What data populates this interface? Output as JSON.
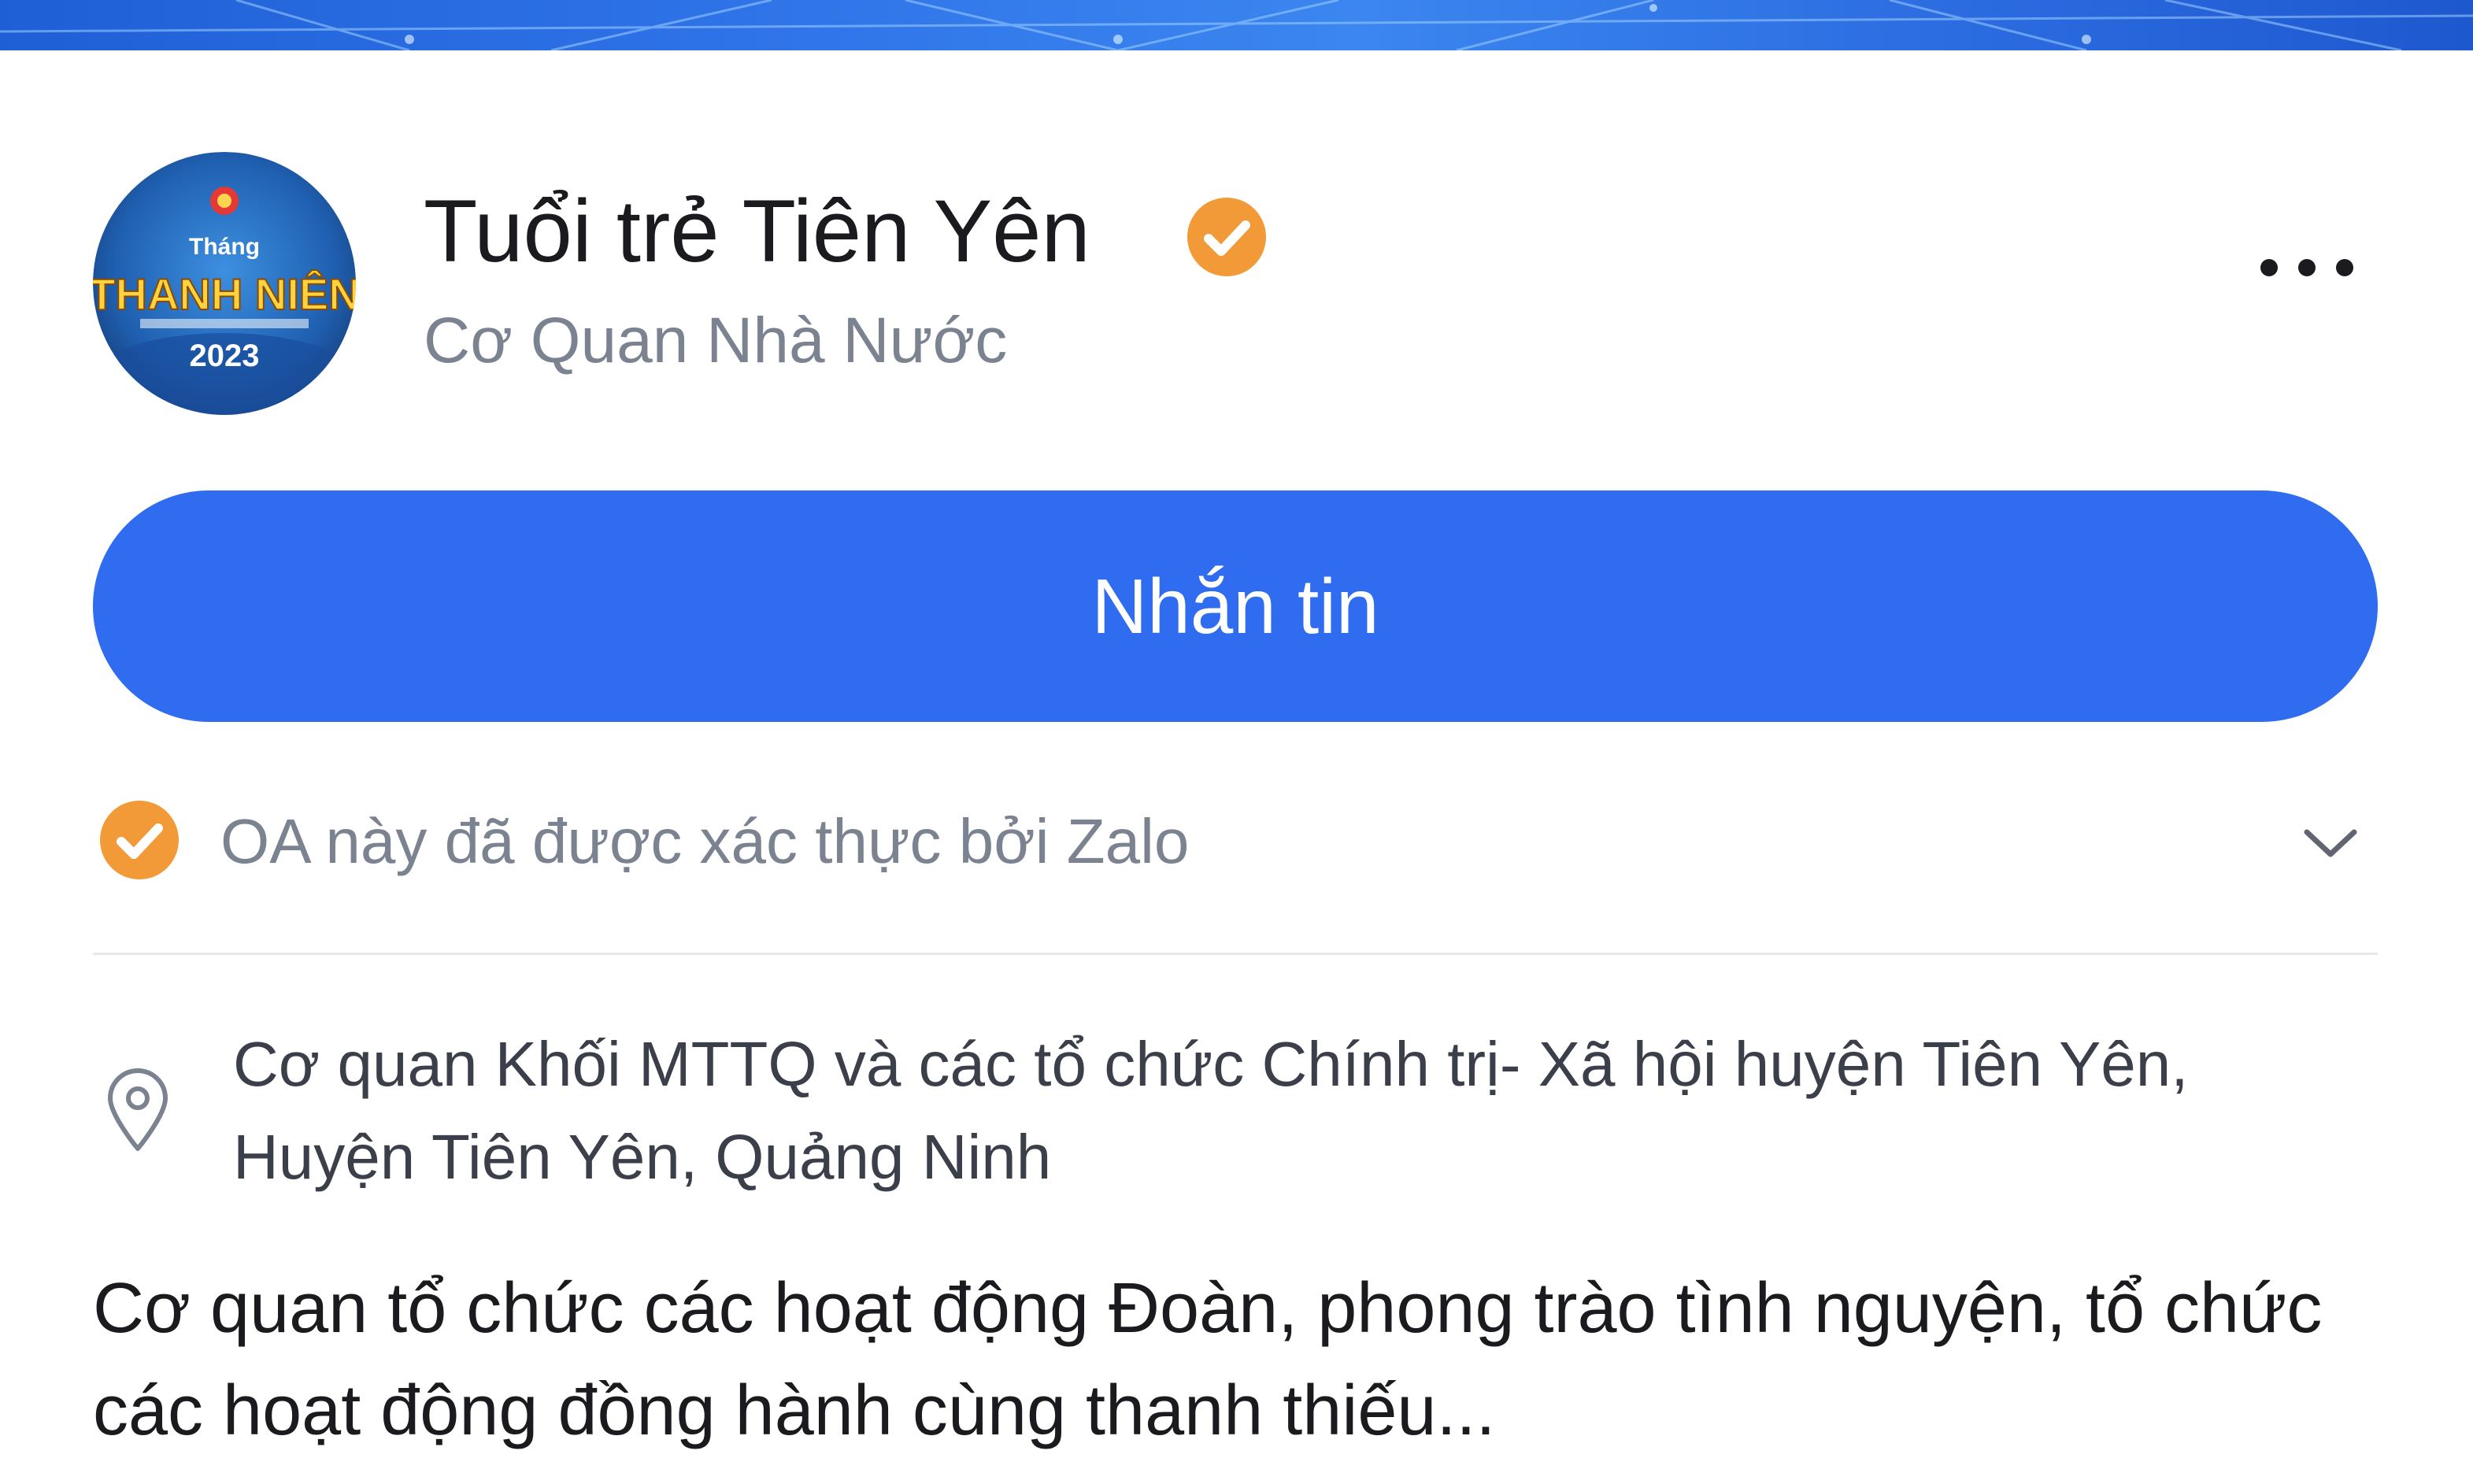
{
  "profile": {
    "name": "Tuổi trẻ Tiên Yên",
    "category": "Cơ Quan Nhà Nước",
    "avatar_text": {
      "line1": "Tháng",
      "line2": "THANH NIÊN",
      "line3": "2023"
    }
  },
  "actions": {
    "message_label": "Nhắn tin",
    "more_icon": "more-horizontal-icon"
  },
  "verification": {
    "text": "OA này đã được xác thực bởi Zalo",
    "icon": "verified-badge-icon"
  },
  "address": {
    "icon": "location-pin-icon",
    "text": "Cơ quan Khối MTTQ và các tổ chức Chính trị- Xã hội huyện Tiên Yên, Huyện Tiên Yên, Quảng Ninh"
  },
  "description": "Cơ quan tổ chức các hoạt động Đoàn, phong trào tình nguyện, tổ chức các hoạt động đồng hành cùng thanh thiếu...",
  "colors": {
    "accent": "#2f6cf0",
    "verified": "#f29a38",
    "muted_text": "#7b8290"
  }
}
